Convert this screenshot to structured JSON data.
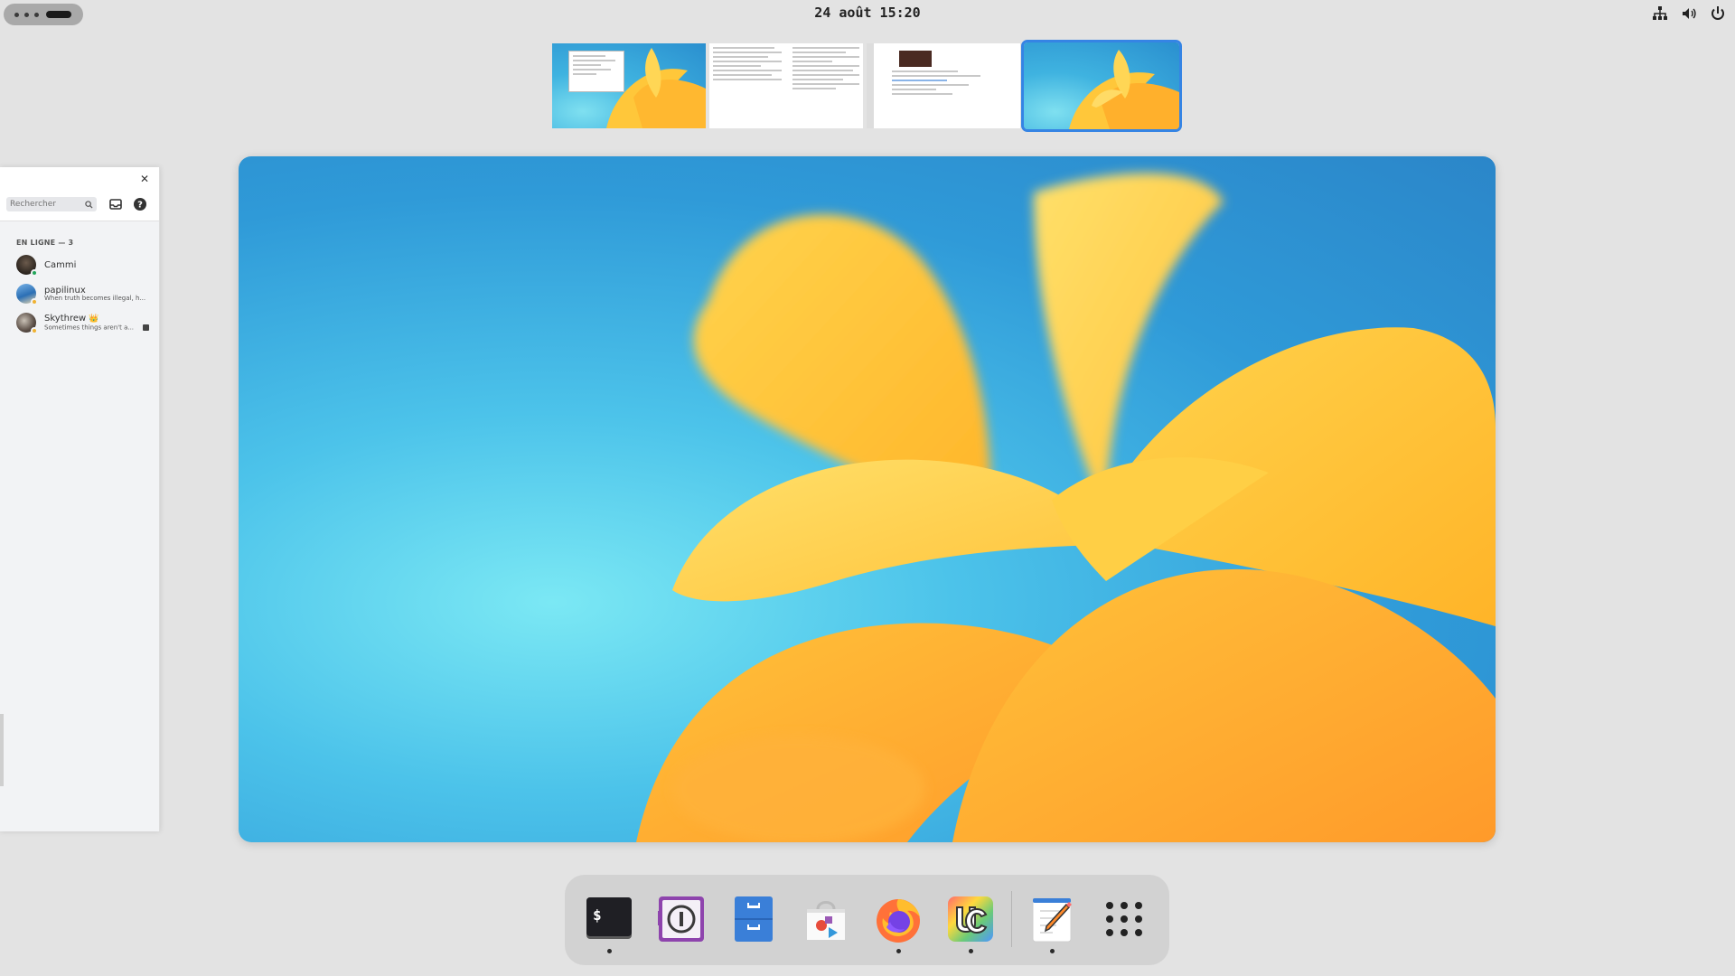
{
  "topbar": {
    "clock": "24 août 15:20",
    "tray_icons": [
      "network-icon",
      "volume-icon",
      "power-icon"
    ]
  },
  "chat_panel": {
    "search_placeholder": "Rechercher",
    "section_title": "EN LIGNE — 3",
    "members": [
      {
        "name": "Cammi",
        "status": "",
        "presence_color": "#23a55a"
      },
      {
        "name": "papilinux",
        "status": "When truth becomes illegal, h...",
        "presence_color": "#f0b232"
      },
      {
        "name": "Skythrew",
        "status": "Sometimes things aren't a...",
        "presence_color": "#f0b232",
        "crown": "👑"
      }
    ]
  },
  "dock": {
    "apps": [
      "terminal",
      "1password",
      "files",
      "software-center",
      "firefox",
      "ubuntu-cleaner",
      "text-editor",
      "show-apps"
    ]
  },
  "colors": {
    "accent": "#3584e4",
    "wallpaper_blue": "#2f9ad8",
    "wallpaper_yellow": "#ffc83a"
  }
}
